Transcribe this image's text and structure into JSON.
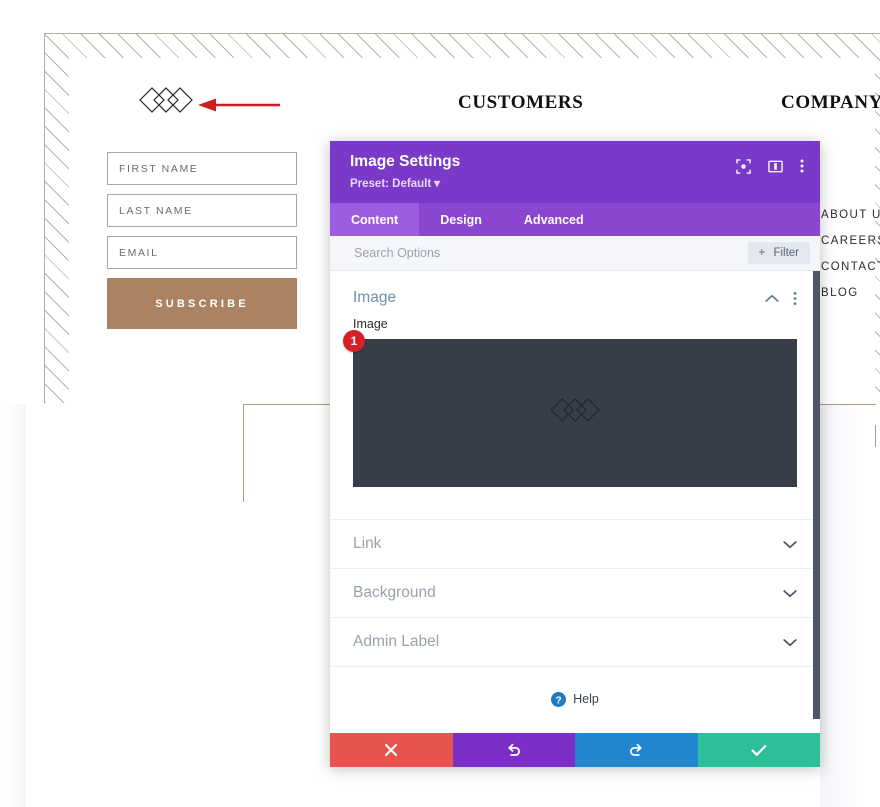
{
  "site": {
    "logo_icon": "triple-diamond-logo-icon",
    "arrow_icon": "red-left-arrow-icon",
    "arrow_color": "#cc1f1f",
    "form": {
      "fields": [
        {
          "placeholder": "FIRST NAME",
          "value": ""
        },
        {
          "placeholder": "LAST NAME",
          "value": ""
        },
        {
          "placeholder": "EMAIL",
          "value": ""
        }
      ],
      "submit_label": "SUBSCRIBE",
      "submit_color": "#ab8262"
    },
    "columns": [
      {
        "heading": "CUSTOMERS",
        "items": []
      },
      {
        "heading": "COMPANY",
        "items": [
          "ABOUT US",
          "CAREERS",
          "CONTACT US",
          "BLOG"
        ]
      }
    ],
    "rule_color": "#b29b81",
    "hatch_color": "#b9b2ab"
  },
  "modal": {
    "title": "Image Settings",
    "preset_label": "Preset: Default",
    "preset_caret": "▾",
    "header_color": "#7b39c9",
    "header_icons": [
      {
        "name": "focus-module-icon"
      },
      {
        "name": "layout-panel-icon"
      },
      {
        "name": "more-options-icon"
      }
    ],
    "tabs": [
      {
        "label": "Content",
        "active": true
      },
      {
        "label": "Design",
        "active": false
      },
      {
        "label": "Advanced",
        "active": false
      }
    ],
    "search": {
      "placeholder": "Search Options",
      "value": ""
    },
    "filter_label": "Filter",
    "filter_icon": "plus-icon",
    "section": {
      "title": "Image",
      "collapse_icon": "chevron-up-icon",
      "options_icon": "more-options-icon",
      "field_label": "Image",
      "badge": "1",
      "badge_color": "#d81f26",
      "preview_icon": "triple-diamond-logo-icon",
      "preview_bg": "#373e4a"
    },
    "accordions": [
      {
        "label": "Link",
        "icon": "chevron-down-icon"
      },
      {
        "label": "Background",
        "icon": "chevron-down-icon"
      },
      {
        "label": "Admin Label",
        "icon": "chevron-down-icon"
      }
    ],
    "help": {
      "label": "Help",
      "icon": "help-circle-icon",
      "color": "#1f7cc4"
    },
    "footer_buttons": [
      {
        "name": "discard-button",
        "icon": "close-icon",
        "color": "#e8534f"
      },
      {
        "name": "undo-button",
        "icon": "undo-icon",
        "color": "#7b2fc7"
      },
      {
        "name": "redo-button",
        "icon": "redo-icon",
        "color": "#2086d0"
      },
      {
        "name": "save-button",
        "icon": "check-icon",
        "color": "#2bbf9a"
      }
    ]
  }
}
